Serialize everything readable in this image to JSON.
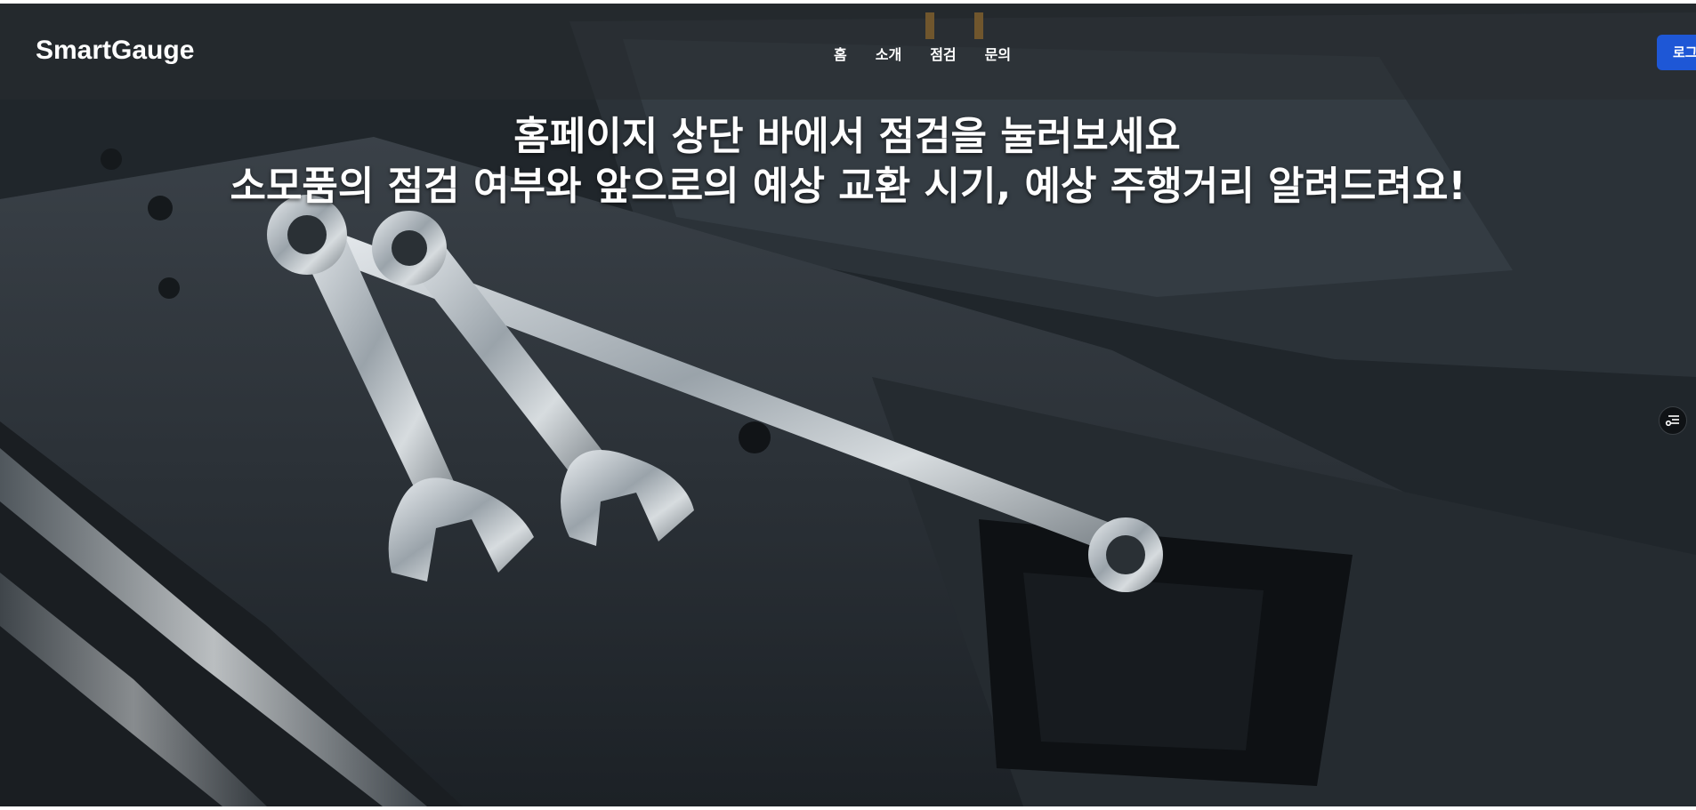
{
  "navbar": {
    "brand": "SmartGauge",
    "links": [
      {
        "label": "홈"
      },
      {
        "label": "소개"
      },
      {
        "label": "점검"
      },
      {
        "label": "문의"
      }
    ],
    "login_label": "로그인"
  },
  "hero": {
    "line1": "홈페이지 상단 바에서 점검을 눌러보세요",
    "line2": "소모품의 점검 여부와 앞으로의 예상 교환 시기, 예상 주행거리 알려드려요!",
    "background": "engine-bay-with-wrenches-photo"
  },
  "side_button": {
    "icon": "filter-settings-icon"
  },
  "colors": {
    "login_button": "#1e57d6",
    "nav_overlay": "rgba(40,44,48,0.55)",
    "text": "#ffffff"
  }
}
